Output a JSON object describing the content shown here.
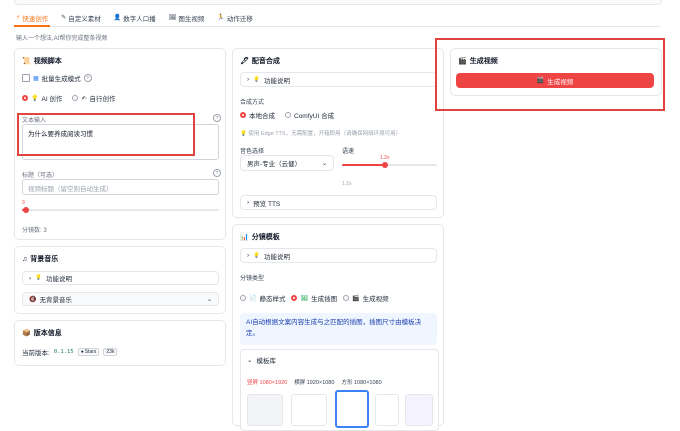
{
  "tabs": [
    {
      "icon": "⚡",
      "label": "快速创作"
    },
    {
      "icon": "✎",
      "label": "自定义素材"
    },
    {
      "icon": "👤",
      "label": "数字人口播"
    },
    {
      "icon": "🖼",
      "label": "图生视频"
    },
    {
      "icon": "🏃",
      "label": "动作迁移"
    }
  ],
  "hint": "输入一个想法,AI帮你完成整条视频",
  "video_script": {
    "title": "视频脚本",
    "batch_label": "批量生成模式",
    "mode_ai": "AI 创作",
    "mode_self": "自行创作",
    "text_input_label": "文本输入",
    "text_input_value": "为什么要养成阅读习惯",
    "title_label": "标题（可选）",
    "title_placeholder": "视频标题（留空则自动生成）",
    "slider_value": "3",
    "slider_fraction": 0.02,
    "shots_label": "分镜数: 3"
  },
  "bgm": {
    "title": "背景音乐",
    "help_label": "功能说明",
    "select_value": "无背景音乐"
  },
  "version": {
    "title": "版本信息",
    "current_label": "当前版本:",
    "version": "0.1.15",
    "stars_label": "Stars",
    "stars_count": "23k"
  },
  "dubbing": {
    "title": "配音合成",
    "help_label": "功能说明",
    "method_label": "合成方式",
    "method_local": "本地合成",
    "method_comfy": "ComfyUI 合成",
    "method_note": "使用 Edge TTS，无需配置，开箱即用（请确保网络环境可用）",
    "voice_label": "音色选择",
    "voice_value": "男声-专业（云健）",
    "speed_label": "语速",
    "speed_value": "1.2x",
    "speed_min": "1.2x",
    "speed_fraction": 0.45,
    "preview_label": "预览 TTS"
  },
  "storyboard": {
    "title": "分镜模板",
    "help_label": "功能说明",
    "type_label": "分镜类型",
    "type_static": "静态样式",
    "type_image": "生成插图",
    "type_video": "生成视频",
    "info": "AI自动根据文案内容生成与之匹配的插图，插图尺寸由模板决定。",
    "library_label": "模板库",
    "sizes": [
      {
        "label": "竖屏 1080×1920",
        "active": true
      },
      {
        "label": "横屏 1920×1080",
        "active": false
      },
      {
        "label": "方形 1080×1080",
        "active": false
      }
    ]
  },
  "generate": {
    "title": "生成视频",
    "button_label": "生成视频"
  },
  "colors": {
    "accent": "#ef4444",
    "tab_active": "#f97316",
    "highlight_box": "#e0443e"
  }
}
